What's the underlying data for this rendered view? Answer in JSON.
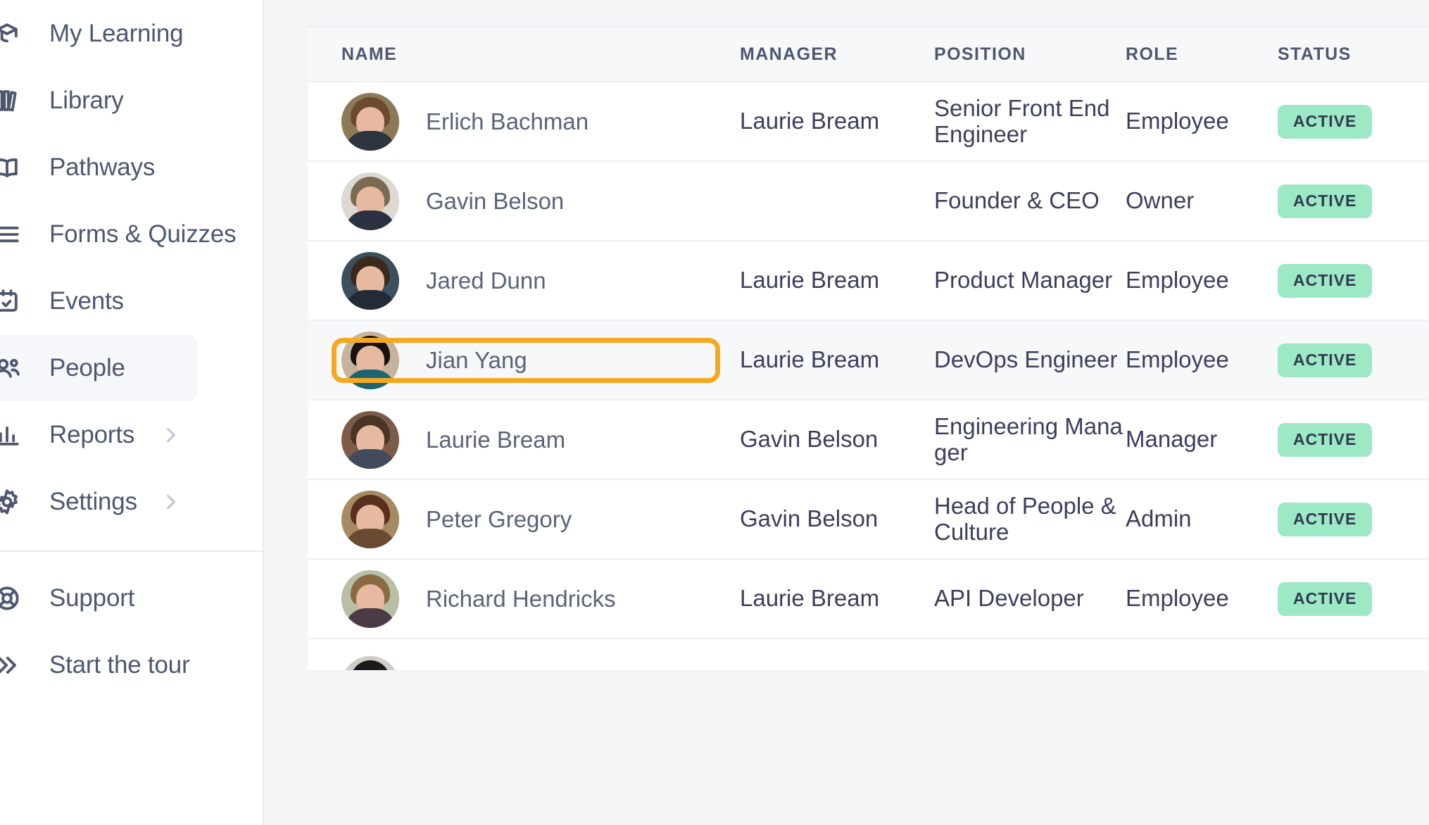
{
  "sidebar": {
    "items": [
      {
        "label": "My Learning",
        "icon": "learning-icon",
        "active": false,
        "chevron": false
      },
      {
        "label": "Library",
        "icon": "library-icon",
        "active": false,
        "chevron": false
      },
      {
        "label": "Pathways",
        "icon": "pathways-icon",
        "active": false,
        "chevron": false
      },
      {
        "label": "Forms & Quizzes",
        "icon": "forms-icon",
        "active": false,
        "chevron": false
      },
      {
        "label": "Events",
        "icon": "events-icon",
        "active": false,
        "chevron": false
      },
      {
        "label": "People",
        "icon": "people-icon",
        "active": true,
        "chevron": false
      },
      {
        "label": "Reports",
        "icon": "reports-icon",
        "active": false,
        "chevron": true
      },
      {
        "label": "Settings",
        "icon": "settings-icon",
        "active": false,
        "chevron": true
      }
    ],
    "footer_items": [
      {
        "label": "Support",
        "icon": "support-icon",
        "active": false,
        "chevron": false
      },
      {
        "label": "Start the tour",
        "icon": "tour-icon",
        "active": false,
        "chevron": false
      }
    ]
  },
  "table": {
    "columns": [
      {
        "key": "name",
        "label": "NAME"
      },
      {
        "key": "manager",
        "label": "MANAGER"
      },
      {
        "key": "position",
        "label": "POSITION"
      },
      {
        "key": "role",
        "label": "ROLE"
      },
      {
        "key": "status",
        "label": "STATUS"
      }
    ],
    "rows": [
      {
        "name": "Erlich Bachman",
        "manager": "Laurie Bream",
        "position": "Senior Front End Engineer",
        "role": "Employee",
        "status": "ACTIVE",
        "selected": false,
        "avatar": {
          "hair": "#6b4a2f",
          "bg": "#8a7a55",
          "body": "#2e3340"
        }
      },
      {
        "name": "Gavin Belson",
        "manager": "",
        "position": "Founder & CEO",
        "role": "Owner",
        "status": "ACTIVE",
        "selected": false,
        "avatar": {
          "hair": "#7a6a52",
          "bg": "#dcd9d2",
          "body": "#2c3242"
        }
      },
      {
        "name": "Jared Dunn",
        "manager": "Laurie Bream",
        "position": "Product Manager",
        "role": "Employee",
        "status": "ACTIVE",
        "selected": false,
        "avatar": {
          "hair": "#3b2a1c",
          "bg": "#3c4f5e",
          "body": "#242a36"
        }
      },
      {
        "name": "Jian Yang",
        "manager": "Laurie Bream",
        "position": "DevOps Engineer",
        "role": "Employee",
        "status": "ACTIVE",
        "selected": true,
        "avatar": {
          "hair": "#17120f",
          "bg": "#c6b39c",
          "body": "#1c6470"
        }
      },
      {
        "name": "Laurie Bream",
        "manager": "Gavin Belson",
        "position": "Engineering Manager",
        "role": "Manager",
        "status": "ACTIVE",
        "selected": false,
        "avatar": {
          "hair": "#4a3426",
          "bg": "#7d5b49",
          "body": "#424a5c"
        }
      },
      {
        "name": "Peter Gregory",
        "manager": "Gavin Belson",
        "position": "Head of People & Culture",
        "role": "Admin",
        "status": "ACTIVE",
        "selected": false,
        "avatar": {
          "hair": "#5a2f1e",
          "bg": "#a58a62",
          "body": "#6b4a33"
        }
      },
      {
        "name": "Richard Hendricks",
        "manager": "Laurie Bream",
        "position": "API Developer",
        "role": "Employee",
        "status": "ACTIVE",
        "selected": false,
        "avatar": {
          "hair": "#8a6a42",
          "bg": "#b8bfa4",
          "body": "#4b3b46"
        }
      }
    ],
    "partial_row": {
      "avatar": {
        "hair": "#1b1b1b",
        "bg": "#d0cdc6",
        "body": "#2b2b2b"
      }
    }
  },
  "colors": {
    "selection_outline": "#f6a821",
    "badge_bg": "#9de8c5",
    "badge_text": "#2f3a52",
    "nav_text": "#4d5770",
    "name_link": "#5a6478",
    "cell_text": "#3b3f5c",
    "page_bg": "#f4f5f7",
    "header_bg": "#f7f8fa"
  }
}
